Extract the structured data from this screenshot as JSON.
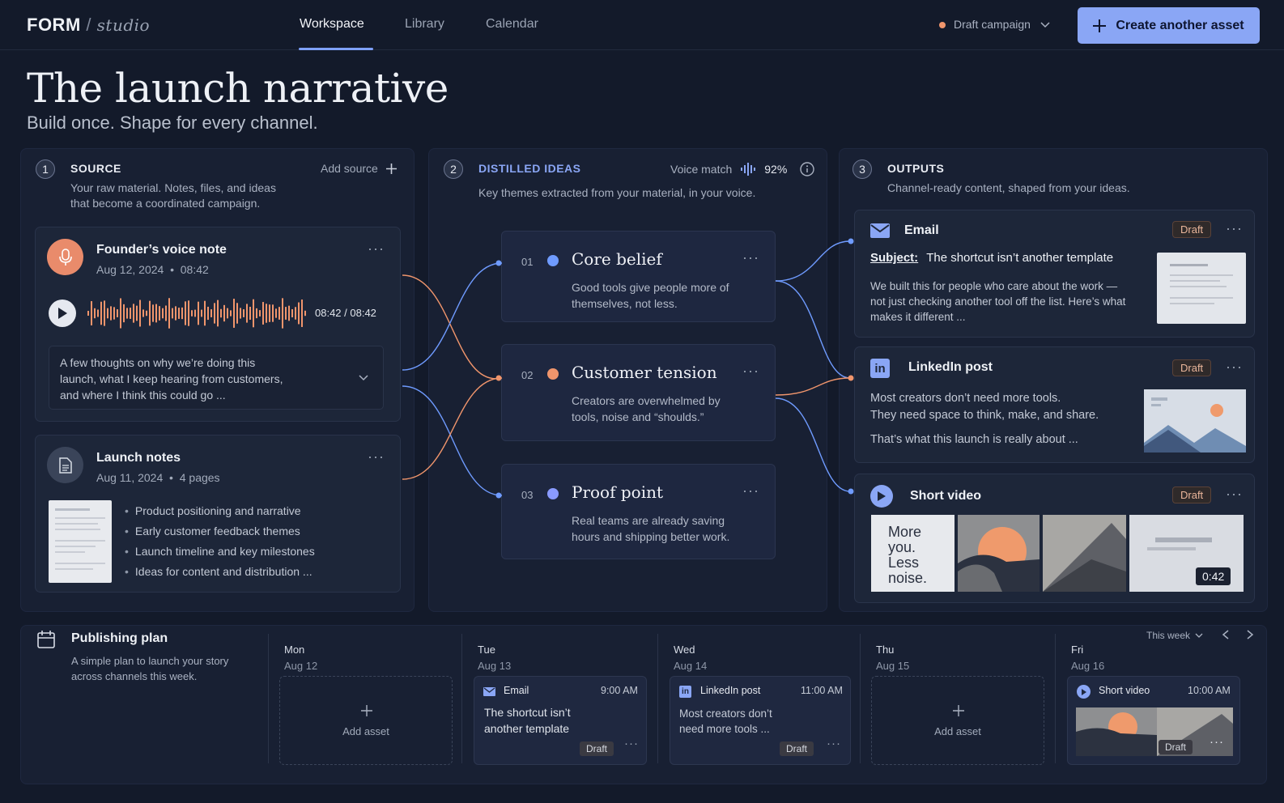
{
  "header": {
    "logo_brand": "FORM",
    "logo_sep": "/",
    "logo_product": "studio",
    "nav": [
      "Workspace",
      "Library",
      "Calendar"
    ],
    "campaign": "Draft campaign",
    "create_btn": "Create another asset"
  },
  "hero": {
    "title": "The launch narrative",
    "subtitle": "Build once. Shape for every channel."
  },
  "source": {
    "num": "1",
    "title": "SOURCE",
    "desc_1": "Your raw material. Notes, files, and ideas",
    "desc_2": "that become a coordinated campaign.",
    "add": "Add source",
    "voice": {
      "title": "Founder’s voice note",
      "date": "Aug 12, 2024",
      "sep": "•",
      "length": "08:42",
      "time": "08:42 / 08:42",
      "transcript_1": "A few thoughts on why we’re doing this",
      "transcript_2": "launch, what I keep hearing from customers,",
      "transcript_3": "and where I think this could go ..."
    },
    "notes": {
      "title": "Launch notes",
      "date": "Aug 11, 2024",
      "sep": "•",
      "pages": "4 pages",
      "bullets": [
        "Product positioning and narrative",
        "Early customer feedback themes",
        "Launch timeline and key milestones",
        "Ideas for content and distribution ..."
      ]
    }
  },
  "ideas": {
    "num": "2",
    "title": "DISTILLED IDEAS",
    "desc": "Key themes extracted from your material, in your voice.",
    "voice_label": "Voice match",
    "voice_pct": "92%",
    "items": [
      {
        "num": "01",
        "title": "Core belief",
        "l1": "Good tools give people more of",
        "l2": "themselves, not less.",
        "color": "#6f9bff"
      },
      {
        "num": "02",
        "title": "Customer tension",
        "l1": "Creators are overwhelmed by",
        "l2": "tools, noise and “shoulds.”",
        "color": "#f0956c"
      },
      {
        "num": "03",
        "title": "Proof point",
        "l1": "Real teams are already saving",
        "l2": "hours and shipping better work.",
        "color": "#8a9bff"
      }
    ]
  },
  "outputs": {
    "num": "3",
    "title": "OUTPUTS",
    "desc": "Channel-ready content, shaped from your ideas.",
    "email": {
      "title": "Email",
      "badge": "Draft",
      "subject_label": "Subject:",
      "subject": "The shortcut isn’t another template",
      "l1": "We built this for people who care about the work —",
      "l2": "not just checking another tool off the list. Here’s what",
      "l3": "makes it different ..."
    },
    "linkedin": {
      "title": "LinkedIn post",
      "badge": "Draft",
      "l1": "Most creators don’t need more tools.",
      "l2": "They need space to think, make, and share.",
      "l3": "That’s what this launch is really about ..."
    },
    "video": {
      "title": "Short video",
      "badge": "Draft",
      "frame_text": [
        "More",
        "you.",
        "Less",
        "noise."
      ],
      "duration": "0:42"
    }
  },
  "plan": {
    "title": "Publishing plan",
    "desc_1": "A simple plan to launch your story",
    "desc_2": "across channels this week.",
    "range": "This week",
    "days": [
      {
        "day": "Mon",
        "date": "Aug 12",
        "add": "Add asset"
      },
      {
        "day": "Tue",
        "date": "Aug 13",
        "type": "Email",
        "time": "9:00 AM",
        "l1": "The shortcut isn’t",
        "l2": "another template",
        "badge": "Draft"
      },
      {
        "day": "Wed",
        "date": "Aug 14",
        "type": "LinkedIn post",
        "time": "11:00 AM",
        "l1": "Most creators don’t",
        "l2": "need more tools ...",
        "badge": "Draft"
      },
      {
        "day": "Thu",
        "date": "Aug 15",
        "add": "Add asset"
      },
      {
        "day": "Fri",
        "date": "Aug 16",
        "type": "Short video",
        "time": "10:00 AM",
        "badge": "Draft"
      }
    ]
  },
  "colors": {
    "accent": "#8aa6f5",
    "orange": "#f0956c",
    "blue": "#6f9bff",
    "bg": "#131a2a"
  }
}
